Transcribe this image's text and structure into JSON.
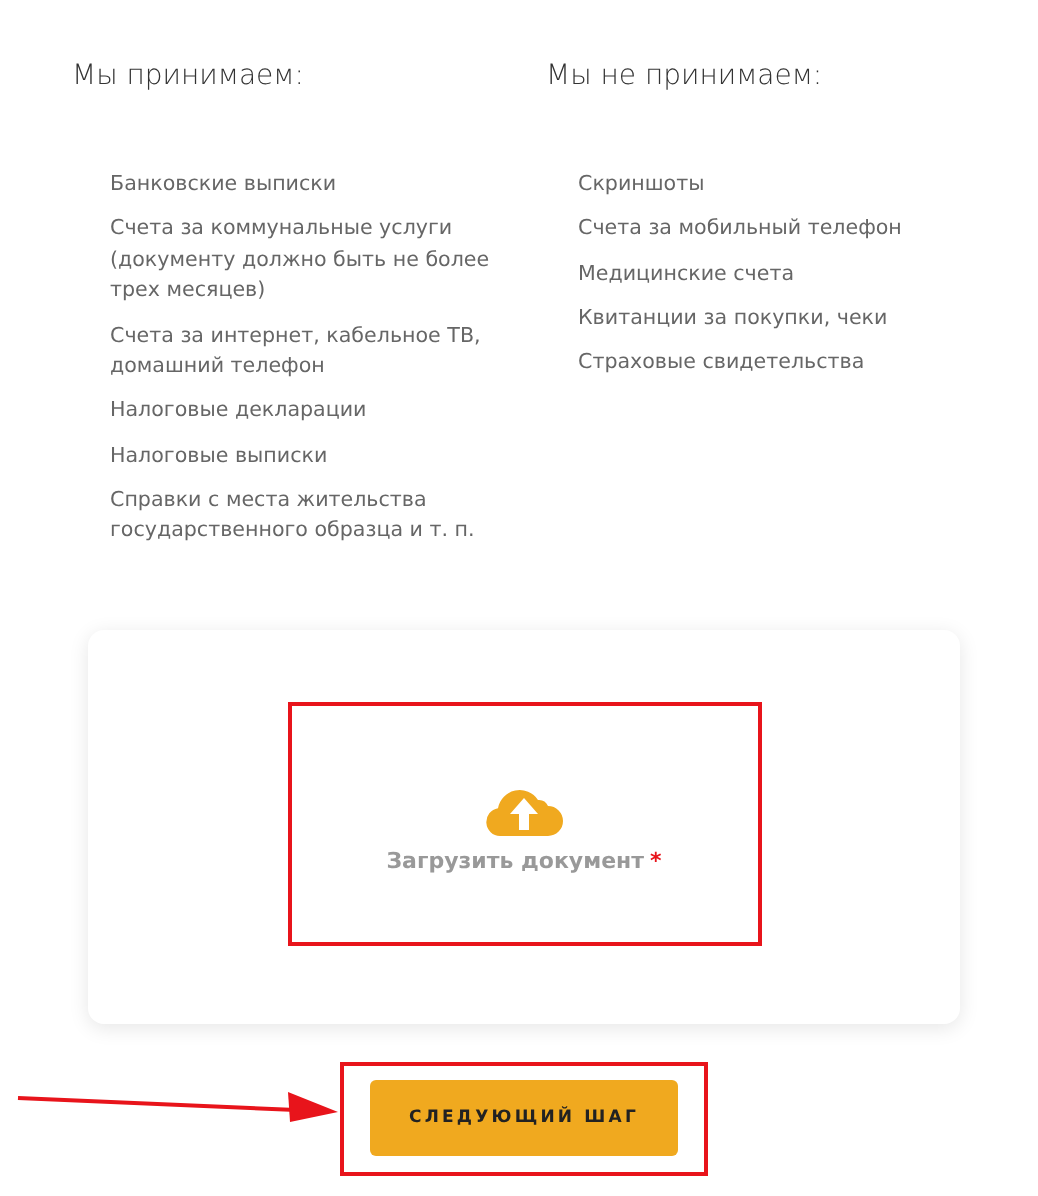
{
  "accepted": {
    "title": "Мы принимаем:",
    "items": [
      "Банковские выписки",
      "Счета за коммунальные услуги (документу должно быть не более трех месяцев)",
      "Счета за интернет, кабельное ТВ, домашний телефон",
      "Налоговые декларации",
      "Налоговые выписки",
      "Справки с места жительства государственного образца и т. п."
    ]
  },
  "not_accepted": {
    "title": "Мы не принимаем:",
    "items": [
      "Скриншоты",
      "Счета за мобильный телефон",
      "Медицинские счета",
      "Квитанции за покупки, чеки",
      "Страховые свидетельства"
    ]
  },
  "upload": {
    "label": "Загрузить документ",
    "required": true,
    "required_mark": "*",
    "highlighted": true
  },
  "next_button": {
    "label": "СЛЕДУЮЩИЙ ШАГ",
    "highlighted": true
  }
}
